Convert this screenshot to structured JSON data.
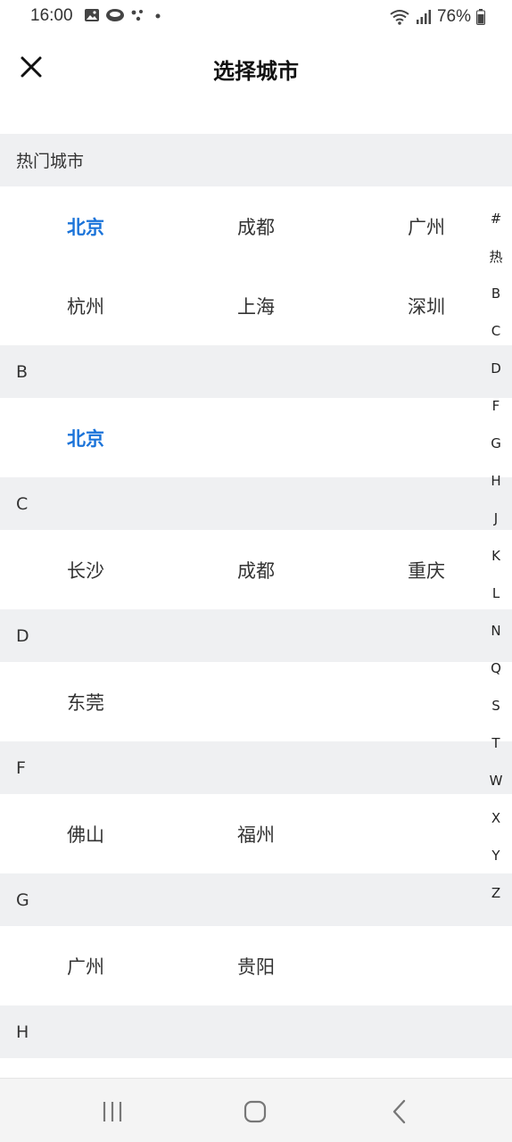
{
  "status": {
    "time": "16:00",
    "battery": "76%"
  },
  "header": {
    "title": "选择城市"
  },
  "sections": [
    {
      "title": "热门城市",
      "rows": [
        [
          "北京",
          "成都",
          "广州"
        ],
        [
          "杭州",
          "上海",
          "深圳"
        ]
      ],
      "active": [
        "北京"
      ]
    },
    {
      "title": "B",
      "rows": [
        [
          "北京"
        ]
      ],
      "active": [
        "北京"
      ]
    },
    {
      "title": "C",
      "rows": [
        [
          "长沙",
          "成都",
          "重庆"
        ]
      ],
      "active": []
    },
    {
      "title": "D",
      "rows": [
        [
          "东莞"
        ]
      ],
      "active": []
    },
    {
      "title": "F",
      "rows": [
        [
          "佛山",
          "福州"
        ]
      ],
      "active": []
    },
    {
      "title": "G",
      "rows": [
        [
          "广州",
          "贵阳"
        ]
      ],
      "active": []
    },
    {
      "title": "H",
      "rows": [],
      "active": []
    }
  ],
  "index": [
    "#",
    "热",
    "B",
    "C",
    "D",
    "F",
    "G",
    "H",
    "J",
    "K",
    "L",
    "N",
    "Q",
    "S",
    "T",
    "W",
    "X",
    "Y",
    "Z"
  ],
  "colors": {
    "active": "#1a73d9",
    "section_bg": "#eff0f2"
  }
}
